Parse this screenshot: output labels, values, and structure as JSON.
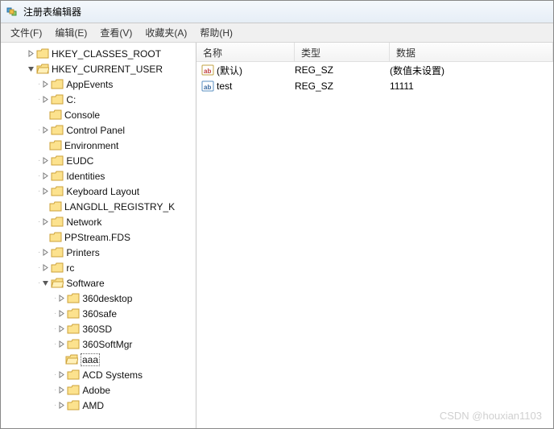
{
  "window": {
    "title": "注册表编辑器"
  },
  "menu": {
    "file": "文件(F)",
    "edit": "编辑(E)",
    "view": "查看(V)",
    "favorites": "收藏夹(A)",
    "help": "帮助(H)"
  },
  "tree": {
    "hkcr": "HKEY_CLASSES_ROOT",
    "hkcu": "HKEY_CURRENT_USER",
    "appevents": "AppEvents",
    "c": "C:",
    "console": "Console",
    "controlpanel": "Control Panel",
    "environment": "Environment",
    "eudc": "EUDC",
    "identities": "Identities",
    "keyboard": "Keyboard Layout",
    "langdll": "LANGDLL_REGISTRY_K",
    "network": "Network",
    "ppstream": "PPStream.FDS",
    "printers": "Printers",
    "rc": "rc",
    "software": "Software",
    "sw_360desktop": "360desktop",
    "sw_360safe": "360safe",
    "sw_360sd": "360SD",
    "sw_360softmgr": "360SoftMgr",
    "sw_aaa": "aaa",
    "sw_acd": "ACD Systems",
    "sw_adobe": "Adobe",
    "sw_amd": "AMD"
  },
  "list": {
    "headers": {
      "name": "名称",
      "type": "类型",
      "data": "数据"
    },
    "rows": [
      {
        "name": "(默认)",
        "type": "REG_SZ",
        "data": "(数值未设置)"
      },
      {
        "name": "test",
        "type": "REG_SZ",
        "data": "11111"
      }
    ]
  },
  "watermark": "CSDN @houxian1103"
}
